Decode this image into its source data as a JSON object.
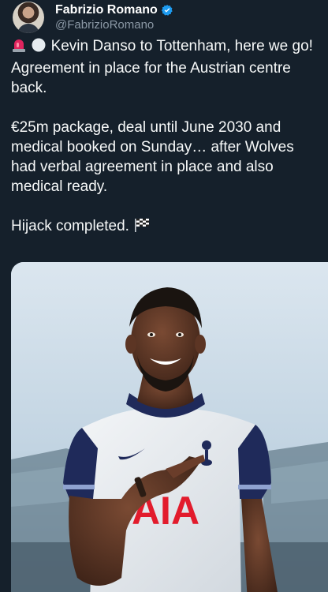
{
  "author": {
    "display_name": "Fabrizio Romano",
    "handle": "@FabrizioRomano",
    "verified": true,
    "avatar_icon": "avatar-photo",
    "verified_icon": "verified-badge-icon"
  },
  "tweet": {
    "line1": "Kevin Danso to Tottenham, here we go! Agreement in place for the Austrian centre back.",
    "line2": "€25m package, deal until June 2030 and medical booked on Sunday… after Wolves had verbal agreement in place and also medical ready.",
    "line3": "Hijack completed.",
    "leading_emojis": [
      "siren-icon",
      "white-circle-icon"
    ],
    "trailing_emoji": "chequered-flag-icon"
  },
  "media": {
    "description_icon": "player-photo",
    "shirt_sponsor": "AIA"
  },
  "colors": {
    "background": "#15202b",
    "text": "#f7f9f9",
    "secondary_text": "#8b98a5",
    "verified_blue": "#1d9bf0",
    "kit_navy": "#1f2a5a"
  }
}
